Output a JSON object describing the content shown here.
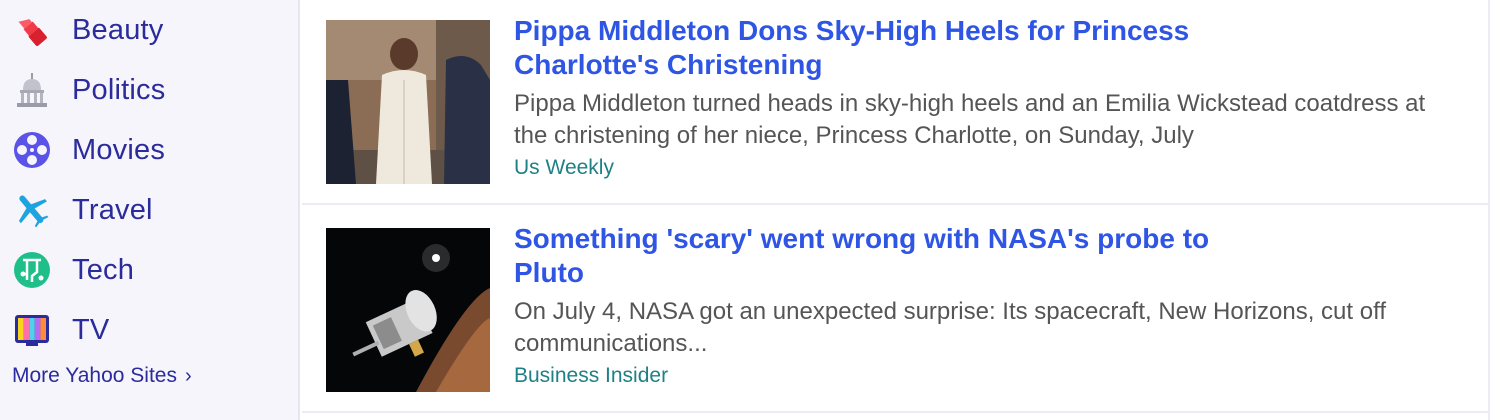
{
  "sidebar": {
    "items": [
      {
        "label": "Beauty",
        "icon": "lipstick-icon"
      },
      {
        "label": "Politics",
        "icon": "capitol-icon"
      },
      {
        "label": "Movies",
        "icon": "film-reel-icon"
      },
      {
        "label": "Travel",
        "icon": "airplane-icon"
      },
      {
        "label": "Tech",
        "icon": "circuit-icon"
      },
      {
        "label": "TV",
        "icon": "tv-icon"
      }
    ],
    "more_label": "More Yahoo Sites",
    "more_chevron": "›"
  },
  "stories": [
    {
      "title": "Pippa Middleton Dons Sky-High Heels for Princess Charlotte's Christening",
      "summary": "Pippa Middleton turned heads in sky-high heels and an Emilia Wickstead coatdress at the christening of her niece, Princess Charlotte, on Sunday, July",
      "source": "Us Weekly"
    },
    {
      "title": "Something 'scary' went wrong with NASA's probe to Pluto",
      "summary": "On July 4, NASA got an unexpected surprise: Its spacecraft, New Horizons, cut off communications...",
      "source": "Business Insider"
    }
  ],
  "colors": {
    "nav_text": "#2b2b9b",
    "headline": "#2f55e4",
    "source": "#1f8085"
  }
}
